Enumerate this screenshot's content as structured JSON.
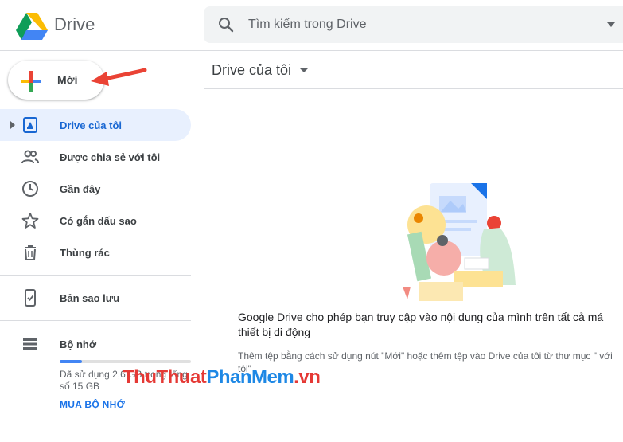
{
  "app": {
    "brand": "Drive"
  },
  "search": {
    "placeholder": "Tìm kiếm trong Drive"
  },
  "new_button": {
    "label": "Mới"
  },
  "sidebar": {
    "items": [
      {
        "label": "Drive của tôi",
        "icon": "my-drive-icon",
        "active": true
      },
      {
        "label": "Được chia sẻ với tôi",
        "icon": "shared-icon"
      },
      {
        "label": "Gần đây",
        "icon": "clock-icon"
      },
      {
        "label": "Có gắn dấu sao",
        "icon": "star-icon"
      },
      {
        "label": "Thùng rác",
        "icon": "trash-icon"
      },
      {
        "label": "Bản sao lưu",
        "icon": "backup-icon"
      },
      {
        "label": "Bộ nhớ",
        "icon": "storage-icon"
      }
    ],
    "storage": {
      "used_text": "Đã sử dụng 2,6 GB trong tổng số 15 GB",
      "used_fraction": 0.17,
      "buy_label": "MUA BỘ NHỚ"
    }
  },
  "main": {
    "title": "Drive của tôi",
    "empty_title": "Google Drive cho phép bạn truy cập vào nội dung của mình trên tất cả má thiết bị di động",
    "empty_subtitle": "Thêm tệp bằng cách sử dụng nút \"Mới\" hoặc thêm tệp vào Drive của tôi từ thư mục \" với tôi\""
  },
  "watermark": {
    "part1": "ThuThuat",
    "part2": "PhanMem",
    "part3": ".vn"
  },
  "colors": {
    "accent": "#1a73e8",
    "active_bg": "#e8f0fe",
    "arrow": "#ea4335"
  }
}
